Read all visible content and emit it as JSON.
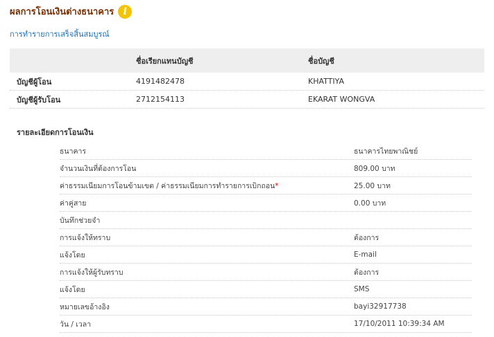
{
  "page": {
    "title": "ผลการโอนเงินต่างธนาคาร",
    "subtitle": "การทำรายการเสร็จสิ้นสมบูรณ์"
  },
  "accounts": {
    "headers": [
      "",
      "ชื่อเรียกแทนบัญชี",
      "ชื่อบัญชี"
    ],
    "rows": [
      {
        "label": "บัญชีผู้โอน",
        "number": "4191482478",
        "name": "KHATTIYA"
      },
      {
        "label": "บัญชีผู้รับโอน",
        "number": "2712154113",
        "name": "EKARAT WONGVA"
      }
    ]
  },
  "details": {
    "section_title": "รายละเอียดการโอนเงิน",
    "rows": [
      {
        "label": "ธนาคาร",
        "value": "ธนาคารไทยพาณิชย์"
      },
      {
        "label": "จำนวนเงินที่ต้องการโอน",
        "value": "809.00 บาท"
      },
      {
        "label": "ค่าธรรมเนียมการโอนข้ามเขต / ค่าธรรมเนียมการทำรายการเบิกถอน",
        "value": "25.00 บาท",
        "marker": "*"
      },
      {
        "label": "ค่าคู่สาย",
        "value": "0.00 บาท"
      },
      {
        "label": "บันทึกช่วยจำ",
        "value": ""
      },
      {
        "label": "การแจ้งให้ทราบ",
        "value": "ต้องการ"
      },
      {
        "label": "แจ้งโดย",
        "value": "E-mail"
      },
      {
        "label": "การแจ้งให้ผู้รับทราบ",
        "value": "ต้องการ"
      },
      {
        "label": "แจ้งโดย",
        "value": "SMS"
      },
      {
        "label": "หมายเลขอ้างอิง",
        "value": "bayi32917738"
      },
      {
        "label": "วัน / เวลา",
        "value": "17/10/2011 10:39:34 AM"
      }
    ]
  },
  "colors": {
    "title": "#7a2f00",
    "link": "#1a6fb5",
    "info_icon": "#f5c400"
  },
  "icons": {
    "info": "info-icon"
  }
}
